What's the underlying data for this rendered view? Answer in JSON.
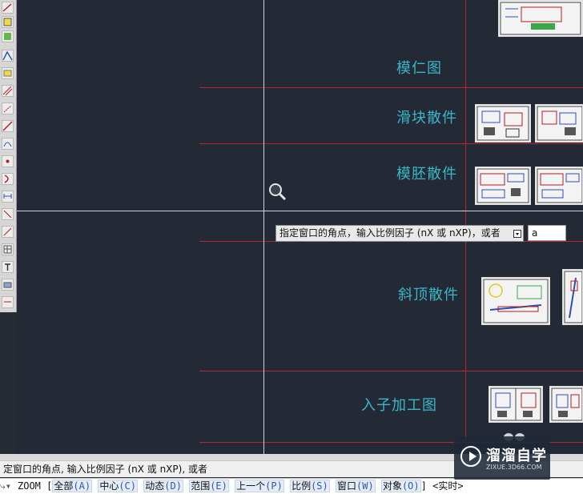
{
  "drawing": {
    "sections": [
      {
        "label": "模仁图"
      },
      {
        "label": "滑块散件"
      },
      {
        "label": "模胚散件"
      },
      {
        "label": "斜顶散件"
      },
      {
        "label": "入子加工图"
      }
    ],
    "grid_color": "#b3282d",
    "label_color": "#39b7c8",
    "background_color": "#232a36"
  },
  "cursor": {
    "icon": "zoom-magnifier-icon"
  },
  "tooltip": {
    "prompt": "指定窗口的角点，输入比例因子 (nX 或 nXP)，或者",
    "dropdown_icon": "chevron-down-icon",
    "input_value": "a"
  },
  "command": {
    "history": "定窗口的角点, 输入比例因子 (nX 或 nXP), 或者",
    "name": "ZOOM",
    "open_bracket": "[",
    "options": [
      {
        "text": "全部",
        "key": "(A)"
      },
      {
        "text": "中心",
        "key": "(C)"
      },
      {
        "text": "动态",
        "key": "(D)"
      },
      {
        "text": "范围",
        "key": "(E)"
      },
      {
        "text": "上一个",
        "key": "(P)"
      },
      {
        "text": "比例",
        "key": "(S)"
      },
      {
        "text": "窗口",
        "key": "(W)"
      },
      {
        "text": "对象",
        "key": "(O)"
      }
    ],
    "close_bracket": "]",
    "default": "<实时>"
  },
  "watermark": {
    "brand": "溜溜自学",
    "site": "ZIXUE.3D66.COM"
  }
}
